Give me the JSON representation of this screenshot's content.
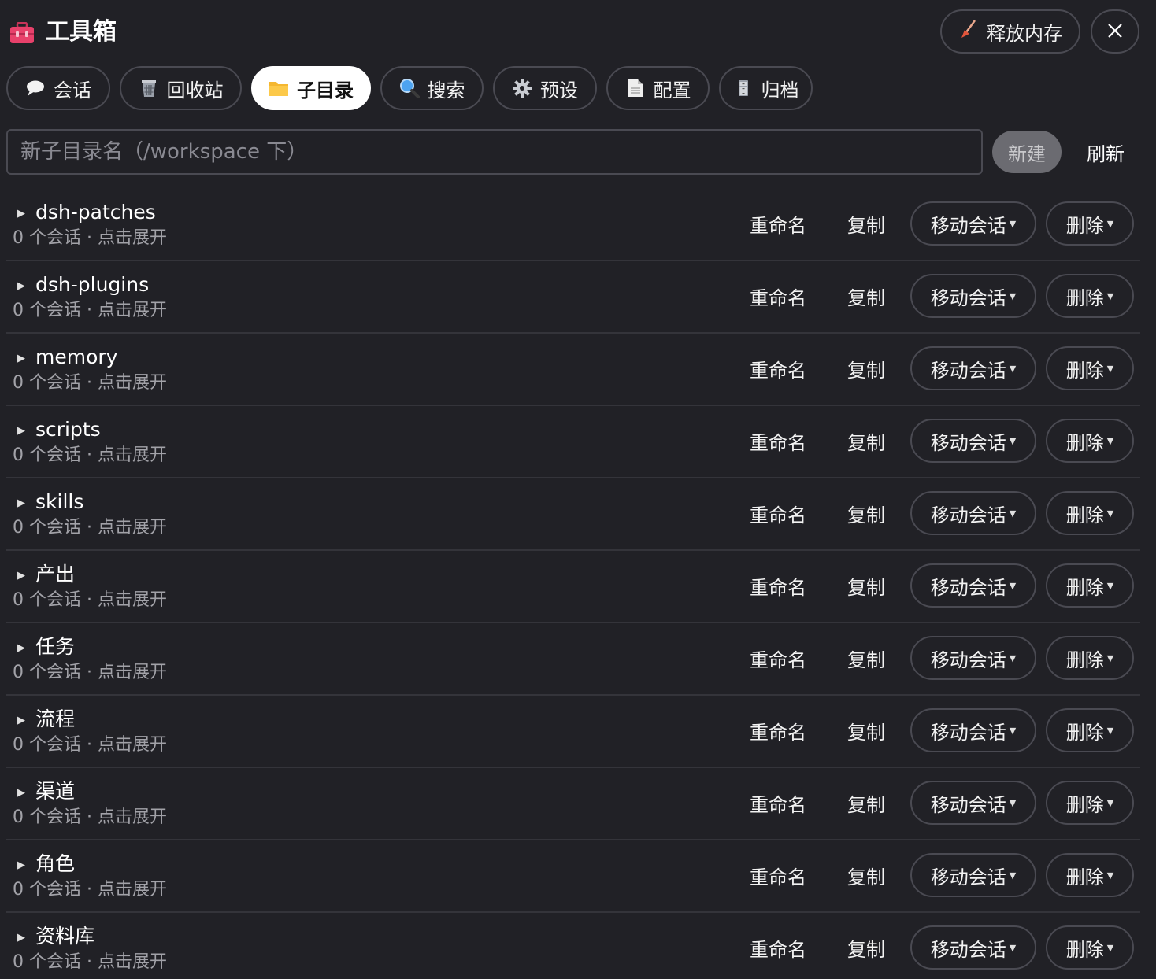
{
  "header": {
    "title": "工具箱",
    "free_memory_label": "释放内存",
    "close_label": "close"
  },
  "tabs": [
    {
      "label": "会话",
      "icon": "speech-bubble-icon",
      "active": false
    },
    {
      "label": "回收站",
      "icon": "wastebasket-icon",
      "active": false
    },
    {
      "label": "子目录",
      "icon": "folder-icon",
      "active": true
    },
    {
      "label": "搜索",
      "icon": "magnifier-icon",
      "active": false
    },
    {
      "label": "预设",
      "icon": "gear-icon",
      "active": false
    },
    {
      "label": "配置",
      "icon": "document-icon",
      "active": false
    },
    {
      "label": "归档",
      "icon": "file-cabinet-icon",
      "active": false
    }
  ],
  "new_dir": {
    "placeholder": "新子目录名（/workspace 下）",
    "value": "",
    "create_label": "新建",
    "refresh_label": "刷新"
  },
  "actions": {
    "rename": "重命名",
    "copy": "复制",
    "move": "移动会话",
    "delete": "删除"
  },
  "dirs": [
    {
      "name": "dsh-patches",
      "subtitle": "0 个会话 · 点击展开"
    },
    {
      "name": "dsh-plugins",
      "subtitle": "0 个会话 · 点击展开"
    },
    {
      "name": "memory",
      "subtitle": "0 个会话 · 点击展开"
    },
    {
      "name": "scripts",
      "subtitle": "0 个会话 · 点击展开"
    },
    {
      "name": "skills",
      "subtitle": "0 个会话 · 点击展开"
    },
    {
      "name": "产出",
      "subtitle": "0 个会话 · 点击展开"
    },
    {
      "name": "任务",
      "subtitle": "0 个会话 · 点击展开"
    },
    {
      "name": "流程",
      "subtitle": "0 个会话 · 点击展开"
    },
    {
      "name": "渠道",
      "subtitle": "0 个会话 · 点击展开"
    },
    {
      "name": "角色",
      "subtitle": "0 个会话 · 点击展开"
    },
    {
      "name": "资料库",
      "subtitle": "0 个会话 · 点击展开"
    }
  ],
  "colors": {
    "background": "#212126",
    "border": "#4a4a52",
    "active_tab": "#ffffff",
    "toolbox_icon": "#e8416b"
  }
}
